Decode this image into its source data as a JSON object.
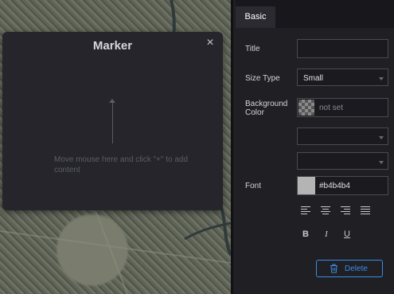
{
  "marker": {
    "title": "Marker",
    "close_label": "×",
    "hint": "Move mouse here and click \"+\" to add content"
  },
  "panel": {
    "tab_basic": "Basic",
    "title_label": "Title",
    "title_value": "",
    "size_type_label": "Size Type",
    "size_type_value": "Small",
    "background_color_label": "Background Color",
    "background_color_value": "not set",
    "select_3_value": "",
    "select_4_value": "",
    "font_label": "Font",
    "font_color_value": "#b4b4b4",
    "align_icons": [
      "align-left-icon",
      "align-center-icon",
      "align-right-icon",
      "align-justify-icon"
    ],
    "style_buttons": {
      "bold": "B",
      "italic": "I",
      "underline": "U"
    },
    "delete_label": "Delete"
  },
  "colors": {
    "accent": "#3a8ee6",
    "font_swatch": "#b4b4b4"
  }
}
